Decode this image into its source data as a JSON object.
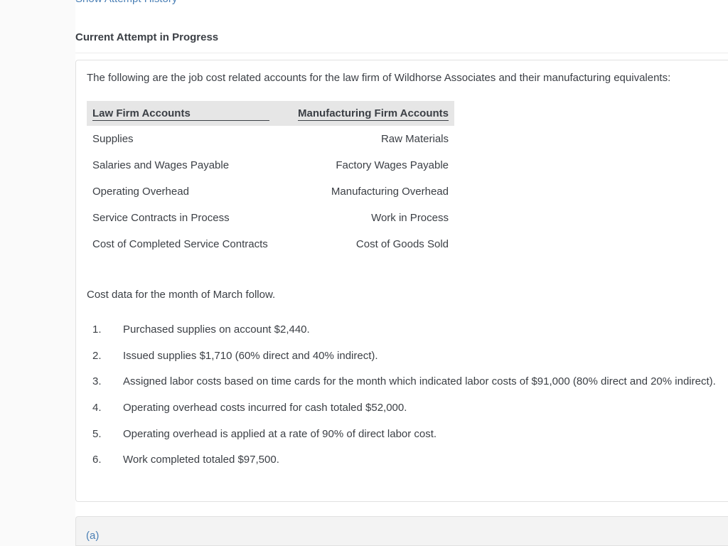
{
  "header": {
    "history_link": "Show Attempt History",
    "attempt_title": "Current Attempt in Progress"
  },
  "problem": {
    "intro": "The following are the job cost related accounts for the law firm of Wildhorse Associates and their manufacturing equivalents:",
    "table": {
      "headers": [
        "Law Firm Accounts",
        "Manufacturing Firm Accounts"
      ],
      "rows": [
        [
          "Supplies",
          "Raw Materials"
        ],
        [
          "Salaries and Wages Payable",
          "Factory Wages Payable"
        ],
        [
          "Operating Overhead",
          "Manufacturing Overhead"
        ],
        [
          "Service Contracts in Process",
          "Work in Process"
        ],
        [
          "Cost of Completed Service Contracts",
          "Cost of Goods Sold"
        ]
      ]
    },
    "cost_intro": "Cost data for the month of March follow.",
    "items": [
      {
        "num": "1.",
        "text": "Purchased supplies on account $2,440."
      },
      {
        "num": "2.",
        "text": "Issued supplies $1,710 (60% direct and 40% indirect)."
      },
      {
        "num": "3.",
        "text": "Assigned labor costs based on time cards for the month which indicated labor costs of $91,000 (80% direct and 20% indirect)."
      },
      {
        "num": "4.",
        "text": "Operating overhead costs incurred for cash totaled $52,000."
      },
      {
        "num": "5.",
        "text": "Operating overhead is applied at a rate of 90% of direct labor cost."
      },
      {
        "num": "6.",
        "text": "Work completed totaled $97,500."
      }
    ]
  },
  "next_section": {
    "part_label": "(a)"
  }
}
